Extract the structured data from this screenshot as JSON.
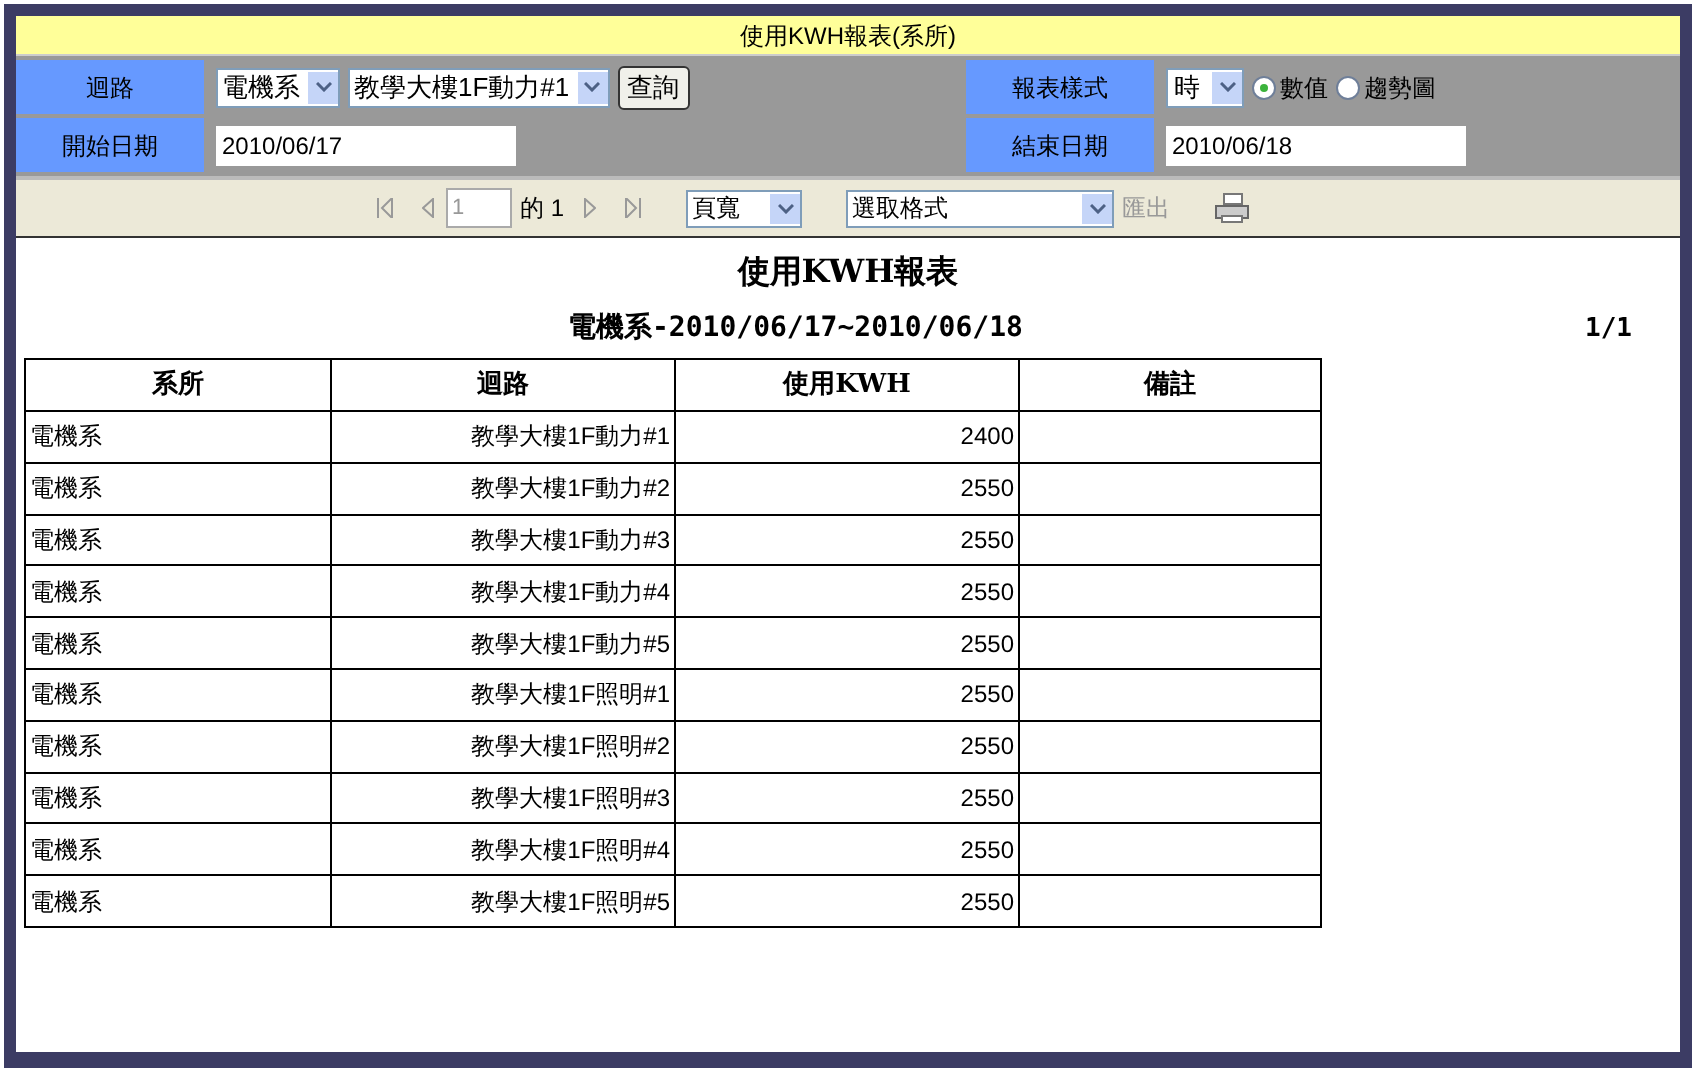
{
  "window": {
    "title": "使用KWH報表(系所)"
  },
  "filters": {
    "circuit_label": "迴路",
    "department": "電機系",
    "circuit": "教學大樓1F動力#1",
    "query_button": "查詢",
    "style_label": "報表樣式",
    "interval": "時",
    "display_options": [
      {
        "label": "數值",
        "selected": true
      },
      {
        "label": "趨勢圖",
        "selected": false
      }
    ],
    "start_label": "開始日期",
    "start_date": "2010/06/17",
    "end_label": "結束日期",
    "end_date": "2010/06/18"
  },
  "toolbar": {
    "page": "1",
    "of_label": "的",
    "page_count": "1",
    "zoom": "頁寬",
    "format": "選取格式",
    "export": "匯出"
  },
  "report": {
    "title": "使用KWH報表",
    "subtitle": "電機系-2010/06/17~2010/06/18",
    "page_indicator": "1/1",
    "columns": [
      "系所",
      "迴路",
      "使用KWH",
      "備註"
    ],
    "rows": [
      [
        "電機系",
        "教學大樓1F動力#1",
        "2400"
      ],
      [
        "電機系",
        "教學大樓1F動力#2",
        "2550"
      ],
      [
        "電機系",
        "教學大樓1F動力#3",
        "2550"
      ],
      [
        "電機系",
        "教學大樓1F動力#4",
        "2550"
      ],
      [
        "電機系",
        "教學大樓1F動力#5",
        "2550"
      ],
      [
        "電機系",
        "教學大樓1F照明#1",
        "2550"
      ],
      [
        "電機系",
        "教學大樓1F照明#2",
        "2550"
      ],
      [
        "電機系",
        "教學大樓1F照明#3",
        "2550"
      ],
      [
        "電機系",
        "教學大樓1F照明#4",
        "2550"
      ],
      [
        "電機系",
        "教學大樓1F照明#5",
        "2550"
      ]
    ]
  }
}
